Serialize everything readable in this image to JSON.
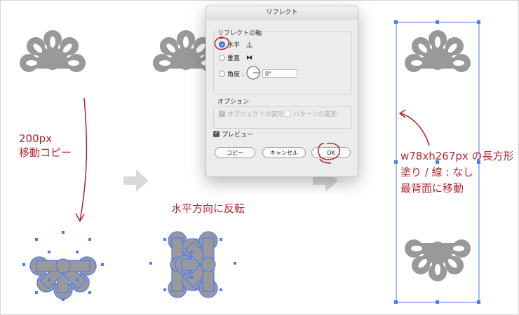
{
  "notes": {
    "move_copy_line1": "200px",
    "move_copy_line2": "移動コピー",
    "flip": "水平方向に反転",
    "rect_line1": "w78xh267px の長方形",
    "rect_line2": "塗り / 線 : なし",
    "rect_line3": "最背面に移動"
  },
  "dialog": {
    "title": "リフレクト",
    "axis_group_label": "リフレクトの軸",
    "horizontal_label": "水平",
    "vertical_label": "垂直",
    "angle_label": "角度 :",
    "angle_value": "0°",
    "options_group_label": "オプション",
    "transform_objects_label": "オブジェクトの変形",
    "transform_patterns_label": "パターンの変形",
    "preview_label": "プレビュー",
    "copy_button": "コピー",
    "cancel_button": "キャンセル",
    "ok_button": "OK",
    "selected_axis": "horizontal"
  },
  "colors": {
    "annotation": "#b32430",
    "shape_fill": "#999999",
    "selection": "#4a7bff",
    "arrow_gray": "#d9d9d9"
  }
}
